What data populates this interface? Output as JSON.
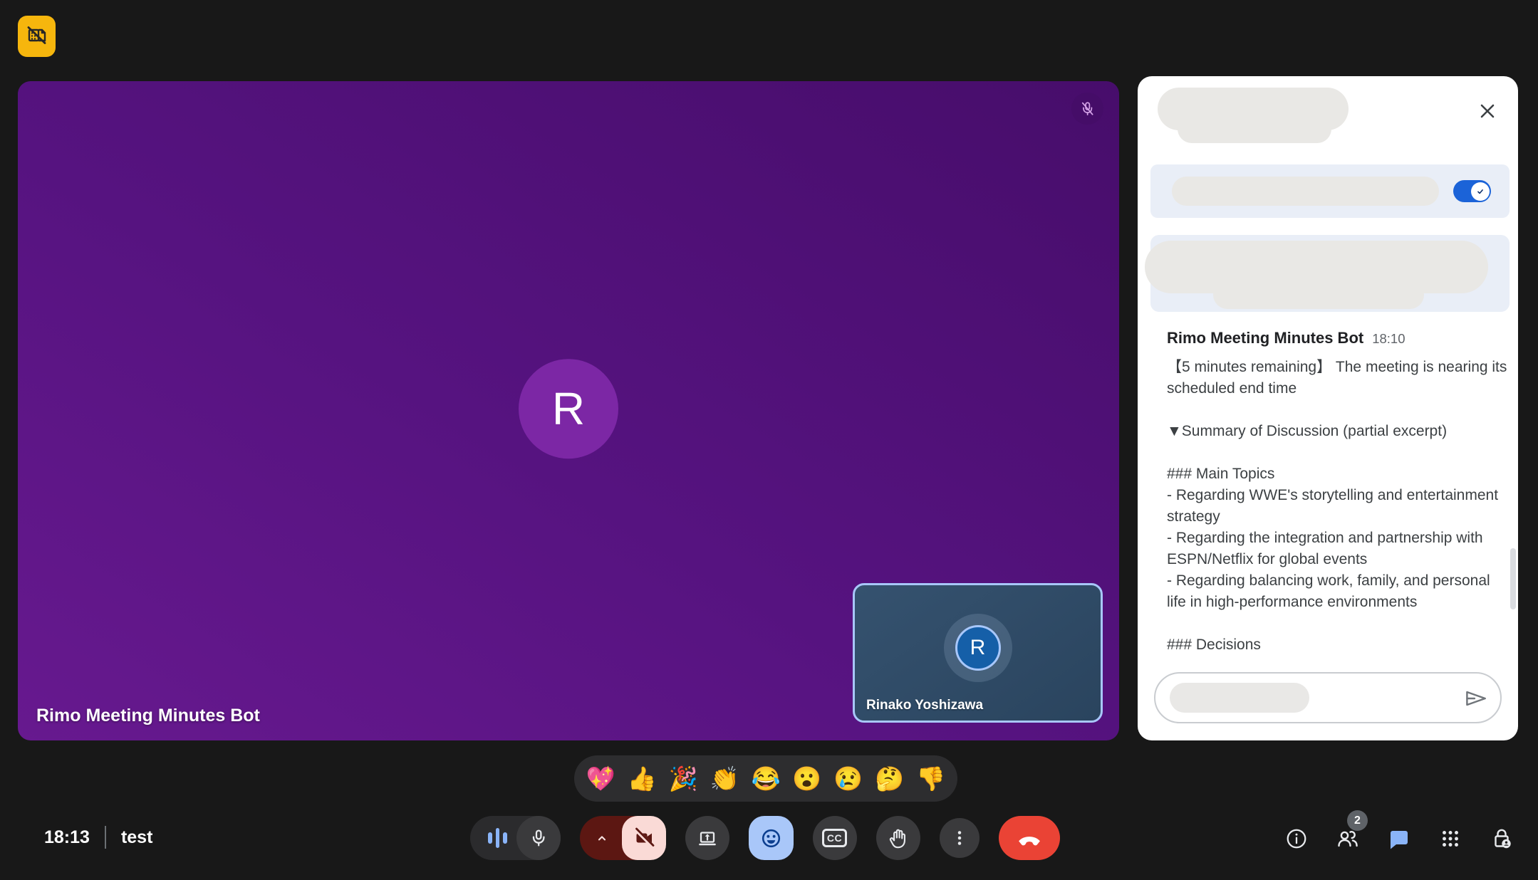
{
  "stage": {
    "main_tile": {
      "label": "Rimo Meeting Minutes Bot",
      "avatar_letter": "R",
      "mic_off": true
    },
    "pip_tile": {
      "label": "Rinako Yoshizawa",
      "avatar_letter": "R",
      "speaking": true
    }
  },
  "chat_panel": {
    "toggle_on": true,
    "message": {
      "sender": "Rimo Meeting Minutes Bot",
      "time": "18:10",
      "body": "【5 minutes remaining】 The meeting is nearing its scheduled end time\n\n▼Summary of Discussion (partial excerpt)\n\n### Main Topics\n- Regarding WWE's storytelling and entertainment strategy\n- Regarding the integration and partnership with ESPN/Netflix for global events\n- Regarding balancing work, family, and personal life in high-performance environments\n\n### Decisions"
    }
  },
  "reactions": {
    "items": [
      "💖",
      "👍",
      "🎉",
      "👏",
      "😂",
      "😮",
      "😢",
      "🤔",
      "👎"
    ]
  },
  "bottom_bar": {
    "clock": "18:13",
    "meeting_name": "test",
    "cc_label": "CC",
    "participants_count": "2"
  },
  "colors": {
    "background": "#181818",
    "main_tile_gradient": [
      "#67198f",
      "#470d6b"
    ],
    "main_avatar": "#7c27a5",
    "pip_border": "#a8c7fa",
    "pip_avatar": "#155fa8",
    "toggle_blue": "#1b63d8",
    "accent_blue": "#8ab4f8",
    "reactions_active_blue": "#a9c7f9",
    "camera_off_pink": "#fadad6",
    "camera_off_maroon": "#5c1712",
    "hangup_red": "#ea4335",
    "logo_yellow": "#f6b60d"
  }
}
